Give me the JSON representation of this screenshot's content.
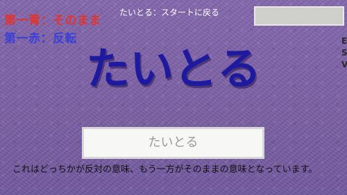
{
  "rules": {
    "rule1": "第一青：そのまま",
    "rule2": "第一赤：反転"
  },
  "header": {
    "hint": "たいとる：スタートに戻る"
  },
  "edge_letters": [
    "E",
    "S",
    "V"
  ],
  "word": "たいとる",
  "answer_input": {
    "placeholder": "たいとる"
  },
  "description": "これはどっちかが反対の意味、もう一方がそのままの意味となっています。",
  "colors": {
    "background": "#7e63a6",
    "rule1": "#e0342f",
    "rule2": "#3a3fd6",
    "word": "#1e1aa0"
  }
}
